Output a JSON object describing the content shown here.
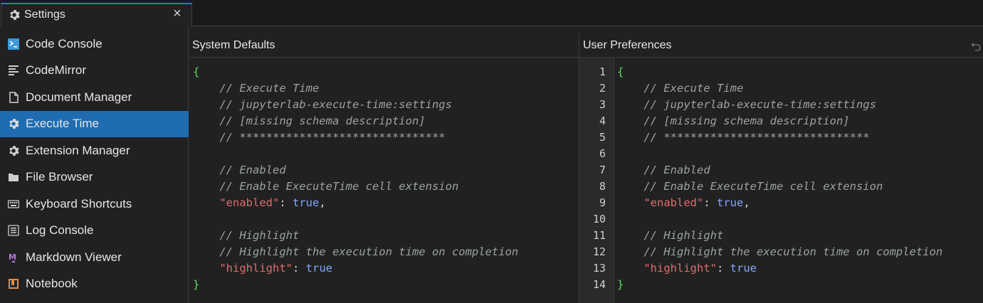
{
  "tab": {
    "title": "Settings",
    "icon": "gear-icon",
    "close": "×"
  },
  "sidebar": {
    "items": [
      {
        "label": "Code Console",
        "icon": "console-icon",
        "active": false
      },
      {
        "label": "CodeMirror",
        "icon": "text-editor-icon",
        "active": false
      },
      {
        "label": "Document Manager",
        "icon": "file-icon",
        "active": false
      },
      {
        "label": "Execute Time",
        "icon": "gear-icon",
        "active": true
      },
      {
        "label": "Extension Manager",
        "icon": "gear-icon",
        "active": false
      },
      {
        "label": "File Browser",
        "icon": "folder-icon",
        "active": false
      },
      {
        "label": "Keyboard Shortcuts",
        "icon": "keyboard-icon",
        "active": false
      },
      {
        "label": "Log Console",
        "icon": "list-icon",
        "active": false
      },
      {
        "label": "Markdown Viewer",
        "icon": "markdown-icon",
        "active": false
      },
      {
        "label": "Notebook",
        "icon": "notebook-icon",
        "active": false
      }
    ]
  },
  "defaults": {
    "title": "System Defaults",
    "lines": [
      "{",
      "    // Execute Time",
      "    // jupyterlab-execute-time:settings",
      "    // [missing schema description]",
      "    // *******************************",
      "",
      "    // Enabled",
      "    // Enable ExecuteTime cell extension",
      "    \"enabled\": true,",
      "",
      "    // Highlight",
      "    // Highlight the execution time on completion",
      "    \"highlight\": true",
      "}"
    ]
  },
  "user": {
    "title": "User Preferences",
    "line_numbers": [
      "1",
      "2",
      "3",
      "4",
      "5",
      "6",
      "7",
      "8",
      "9",
      "10",
      "11",
      "12",
      "13",
      "14"
    ],
    "lines": [
      "{",
      "    // Execute Time",
      "    // jupyterlab-execute-time:settings",
      "    // [missing schema description]",
      "    // *******************************",
      "",
      "    // Enabled",
      "    // Enable ExecuteTime cell extension",
      "    \"enabled\": true,",
      "",
      "    // Highlight",
      "    // Highlight the execution time on completion",
      "    \"highlight\": true",
      "}"
    ]
  },
  "colors": {
    "accent": "#1f6cb0",
    "comment": "#9aa3a0",
    "key": "#e06c6c",
    "value": "#82a6ff",
    "brace": "#5ddc5d"
  }
}
